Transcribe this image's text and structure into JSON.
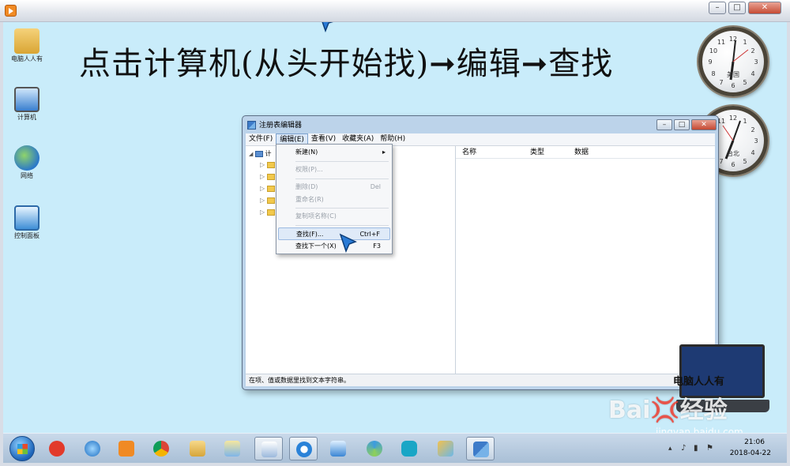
{
  "headline": "点击计算机(从头开始找)➞编辑➞查找",
  "desktop_icons": [
    {
      "name": "user-folder",
      "label": "电脑人人有"
    },
    {
      "name": "computer",
      "label": "计算机"
    },
    {
      "name": "network",
      "label": "网络"
    },
    {
      "name": "control-panel",
      "label": "控制面板"
    }
  ],
  "clocks": [
    {
      "city": "美国"
    },
    {
      "city": "台北"
    }
  ],
  "regedit": {
    "title": "注册表编辑器",
    "menus": [
      "文件(F)",
      "编辑(E)",
      "查看(V)",
      "收藏夹(A)",
      "帮助(H)"
    ],
    "tree_root": "计",
    "columns": [
      "名称",
      "类型",
      "数据"
    ],
    "status": "在项、值或数据里找到文本字符串。"
  },
  "edit_menu": [
    {
      "label": "新建(N)",
      "shortcut": "",
      "disabled": false,
      "submenu": true
    },
    {
      "label": "权限(P)...",
      "shortcut": "",
      "disabled": true
    },
    {
      "label": "删除(D)",
      "shortcut": "Del",
      "disabled": true
    },
    {
      "label": "重命名(R)",
      "shortcut": "",
      "disabled": true
    },
    {
      "label": "复制项名称(C)",
      "shortcut": "",
      "disabled": true
    },
    {
      "label": "查找(F)...",
      "shortcut": "Ctrl+F",
      "disabled": false,
      "highlighted": true
    },
    {
      "label": "查找下一个(X)",
      "shortcut": "F3",
      "disabled": false
    }
  ],
  "logo": {
    "brand": "电脑人人有"
  },
  "watermark": {
    "text": "Bai💢经验",
    "sub": "jingyan.baidu.com"
  },
  "tray": {
    "time": "21:06",
    "date": "2018-04-22"
  },
  "colors": {
    "desktop": "#c9ecfa",
    "menu_highlight": "#dfeaf8",
    "title_close": "#c64b34"
  }
}
